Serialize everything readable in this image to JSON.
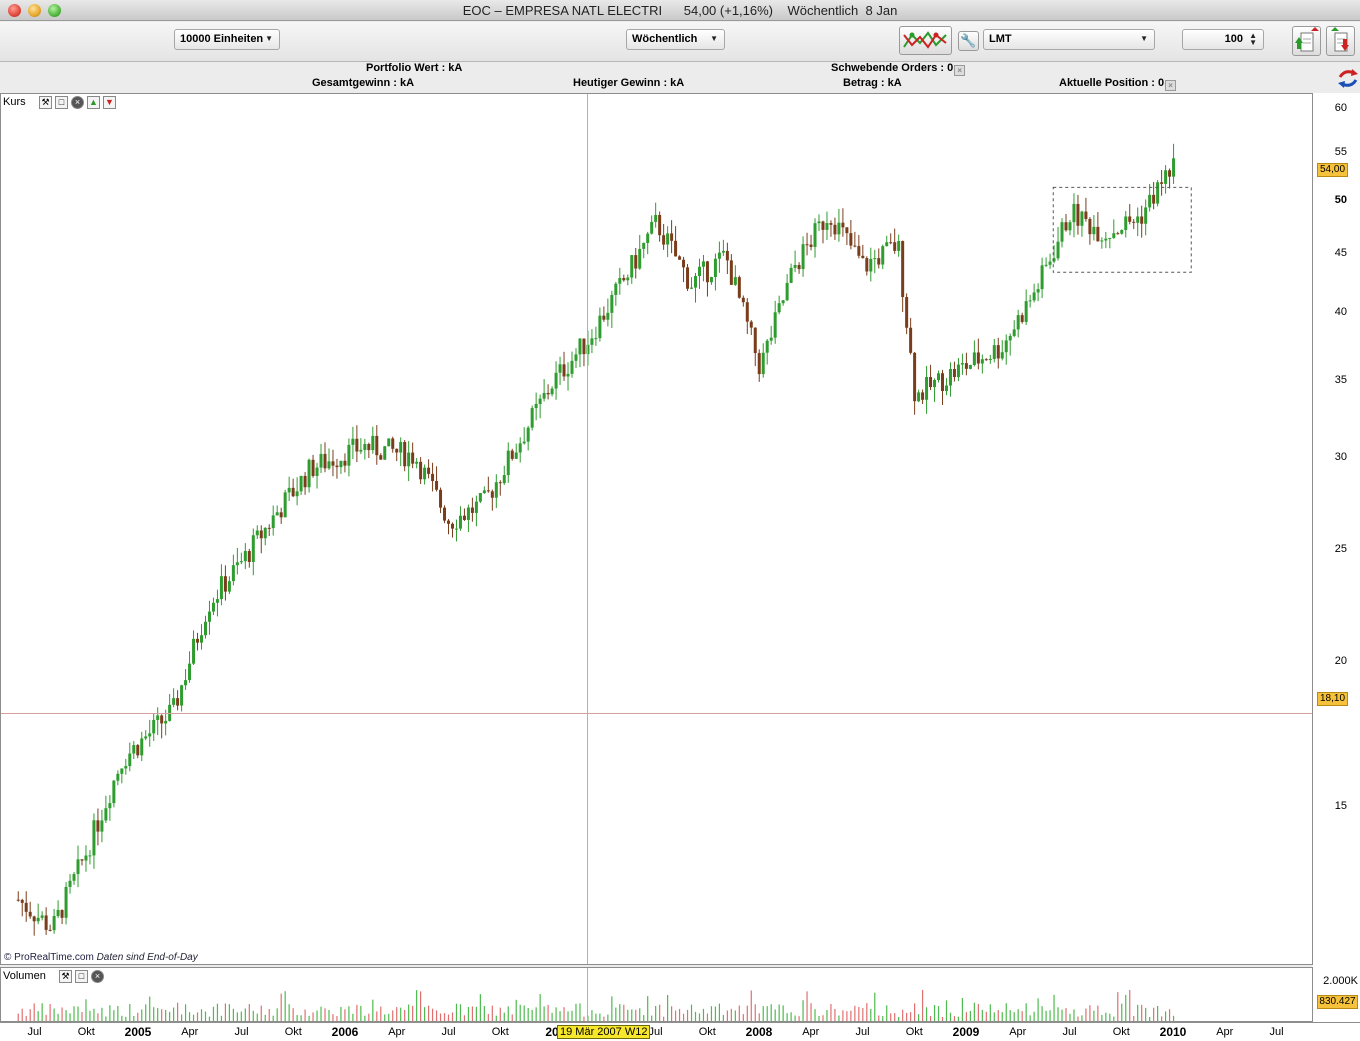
{
  "window": {
    "title": "EOC – EMPRESA NATL ELECTRI      54,00 (+1,16%)    Wöchentlich  8 Jan"
  },
  "toolbar": {
    "units_select": "10000 Einheiten",
    "period_select": "Wöchentlich",
    "order_type_select": "LMT",
    "quantity_value": "100"
  },
  "info": {
    "portfolio": "Portfolio Wert : kA",
    "total_gain": "Gesamtgewinn : kA",
    "today_gain": "Heutiger Gewinn : kA",
    "pending_orders": "Schwebende Orders : 0",
    "amount": "Betrag : kA",
    "position": "Aktuelle Position : 0"
  },
  "price_panel": {
    "label": "Kurs",
    "last_price_tag": "54,00",
    "crosshair_price_tag": "18,10",
    "copyright": "© ProRealTime.com",
    "copyright_note": "Daten sind End-of-Day"
  },
  "volume_panel": {
    "label": "Volumen",
    "max_tick": "2.000K",
    "last_volume_tag": "830.427"
  },
  "crosshair_date": "19 Mär 2007 W12",
  "y_ticks": [
    "60",
    "55",
    "50",
    "45",
    "40",
    "35",
    "30",
    "25",
    "20",
    "15"
  ],
  "x_ticks": [
    "Jul",
    "Okt",
    "2005",
    "Apr",
    "Jul",
    "Okt",
    "2006",
    "Apr",
    "Jul",
    "Okt",
    "20",
    "Jul",
    "Okt",
    "2008",
    "Apr",
    "Jul",
    "Okt",
    "2009",
    "Apr",
    "Jul",
    "Okt",
    "2010",
    "Apr",
    "Jul"
  ],
  "chart_data": {
    "type": "candlestick",
    "symbol": "EOC",
    "interval": "Wöchentlich",
    "y_scale": "log",
    "ylim": [
      11,
      62
    ],
    "x_range": [
      "2004-05",
      "2010-09"
    ],
    "last_close": 54.0,
    "change_pct": "+1,16%",
    "approx_weekly_closes": [
      {
        "date": "2004-06",
        "close": 12.5
      },
      {
        "date": "2004-08",
        "close": 11.8
      },
      {
        "date": "2004-10",
        "close": 13.8
      },
      {
        "date": "2004-12",
        "close": 16.5
      },
      {
        "date": "2005-03",
        "close": 18.2
      },
      {
        "date": "2005-05",
        "close": 22.5
      },
      {
        "date": "2005-07",
        "close": 24.5
      },
      {
        "date": "2005-09",
        "close": 27.0
      },
      {
        "date": "2005-11",
        "close": 29.5
      },
      {
        "date": "2006-02",
        "close": 30.8
      },
      {
        "date": "2006-05",
        "close": 30.2
      },
      {
        "date": "2006-07",
        "close": 26.5
      },
      {
        "date": "2006-09",
        "close": 27.5
      },
      {
        "date": "2006-11",
        "close": 31.0
      },
      {
        "date": "2007-01",
        "close": 35.0
      },
      {
        "date": "2007-03",
        "close": 38.0
      },
      {
        "date": "2007-05",
        "close": 42.5
      },
      {
        "date": "2007-07",
        "close": 48.0
      },
      {
        "date": "2007-09",
        "close": 42.5
      },
      {
        "date": "2007-11",
        "close": 45.0
      },
      {
        "date": "2008-01",
        "close": 36.0
      },
      {
        "date": "2008-03",
        "close": 44.0
      },
      {
        "date": "2008-05",
        "close": 49.0
      },
      {
        "date": "2008-07",
        "close": 44.0
      },
      {
        "date": "2008-09",
        "close": 46.0
      },
      {
        "date": "2008-10",
        "close": 34.0
      },
      {
        "date": "2008-12",
        "close": 35.5
      },
      {
        "date": "2009-03",
        "close": 37.5
      },
      {
        "date": "2009-05",
        "close": 42.0
      },
      {
        "date": "2009-07",
        "close": 49.0
      },
      {
        "date": "2009-09",
        "close": 47.0
      },
      {
        "date": "2009-11",
        "close": 48.5
      },
      {
        "date": "2010-01",
        "close": 54.0
      }
    ],
    "volume_max_label": "2.000K",
    "last_volume": "830.427",
    "colors": {
      "up": "#2e9c2e",
      "down": "#7a3d1c",
      "vol_up": "#4dbb4d",
      "vol_down": "#e07070",
      "crosshair": "#d7a0a0"
    }
  }
}
